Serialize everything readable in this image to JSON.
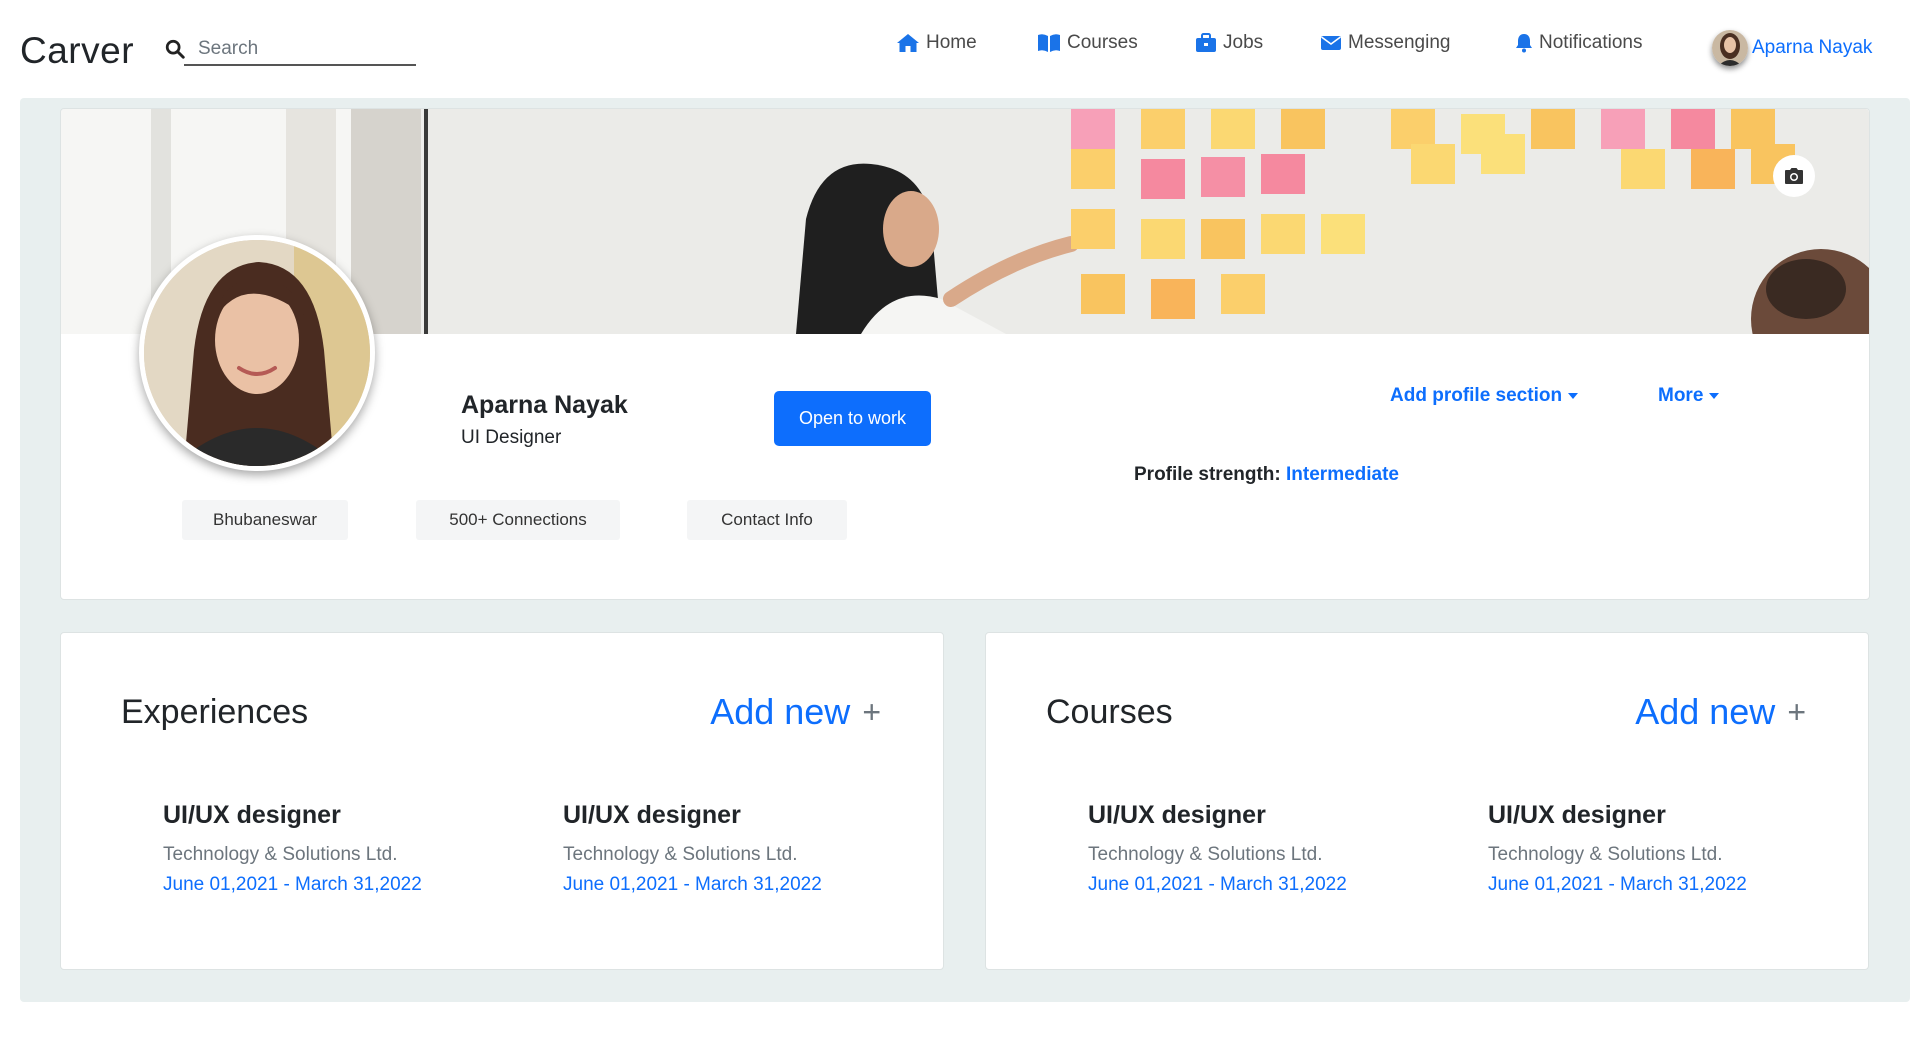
{
  "navbar": {
    "brand": "Carver",
    "search_placeholder": "Search",
    "items": [
      {
        "label": "Home",
        "icon": "home-icon"
      },
      {
        "label": "Courses",
        "icon": "book-icon"
      },
      {
        "label": "Jobs",
        "icon": "briefcase-icon"
      },
      {
        "label": "Messenging",
        "icon": "envelope-icon"
      },
      {
        "label": "Notifications",
        "icon": "bell-icon"
      }
    ],
    "user_name": "Aparna Nayak"
  },
  "profile": {
    "name": "Aparna Nayak",
    "title": "UI Designer",
    "open_to_work": "Open to work",
    "add_section": "Add profile section",
    "more": "More",
    "strength_label": "Profile strength:",
    "strength_value": "Intermediate",
    "chips": [
      "Bhubaneswar",
      "500+ Connections",
      "Contact Info"
    ]
  },
  "experiences": {
    "title": "Experiences",
    "add_label": "Add new",
    "add_symbol": "+",
    "items": [
      {
        "role": "UI/UX designer",
        "company": "Technology & Solutions Ltd.",
        "dates": "June 01,2021 - March 31,2022"
      },
      {
        "role": "UI/UX designer",
        "company": "Technology & Solutions Ltd.",
        "dates": "June 01,2021 - March 31,2022"
      }
    ]
  },
  "courses": {
    "title": "Courses",
    "add_label": "Add new",
    "add_symbol": "+",
    "items": [
      {
        "role": "UI/UX designer",
        "company": "Technology & Solutions Ltd.",
        "dates": "June 01,2021 - March 31,2022"
      },
      {
        "role": "UI/UX designer",
        "company": "Technology & Solutions Ltd.",
        "dates": "June 01,2021 - March 31,2022"
      }
    ]
  },
  "colors": {
    "accent": "#0d6efd",
    "page_background": "#e8efef",
    "nav_icon": "#1a73e8"
  }
}
